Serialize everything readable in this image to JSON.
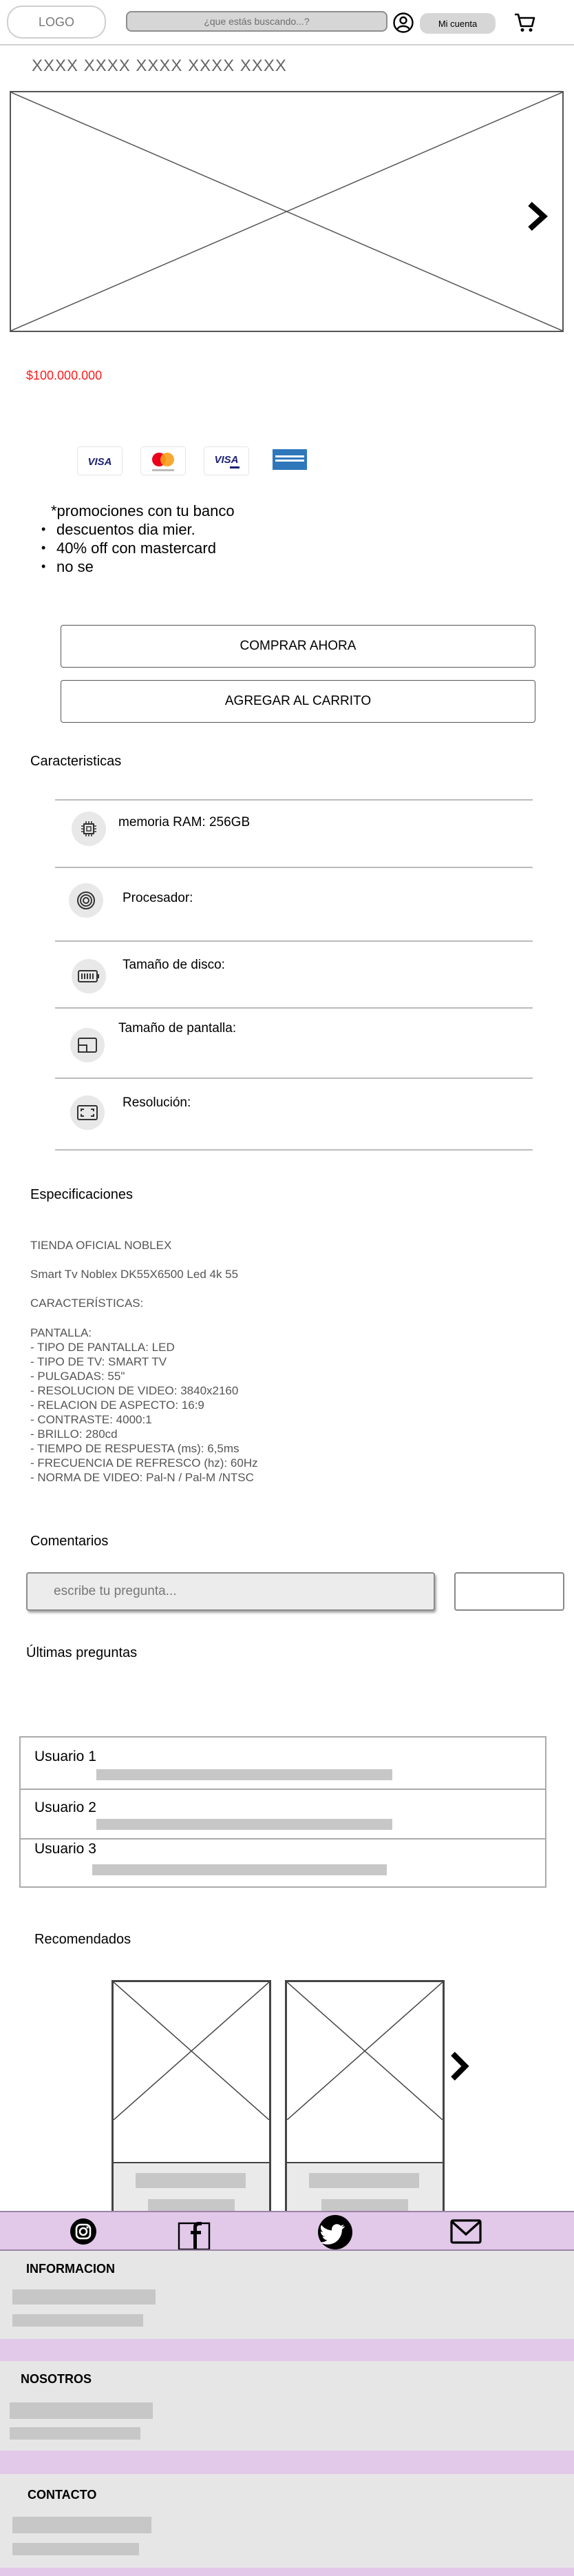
{
  "header": {
    "logo": "LOGO",
    "search_placeholder": "¿que estás buscando...?",
    "account_label": "Mi cuenta"
  },
  "product": {
    "title": "XXXX XXXX XXXX XXXX XXXX",
    "price": "$100.000.000",
    "price_color": "#ff1a1a"
  },
  "payment_cards": [
    "VISA",
    "MASTERCARD",
    "VISA DEBITO",
    "AMERICAN EXPRESS"
  ],
  "promotions": {
    "heading": "*promociones con tu banco",
    "items": [
      "descuentos dia mier.",
      "40% off con mastercard",
      "no se"
    ]
  },
  "buttons": {
    "buy_now": "COMPRAR AHORA",
    "add_to_cart": "AGREGAR AL CARRITO"
  },
  "features": {
    "title": "Caracteristicas",
    "items": [
      {
        "icon": "chip-icon",
        "label": "memoria RAM: 256GB"
      },
      {
        "icon": "processor-icon",
        "label": "Procesador:"
      },
      {
        "icon": "battery-disk-icon",
        "label": "Tamaño de disco:"
      },
      {
        "icon": "screen-size-icon",
        "label": "Tamaño de pantalla:"
      },
      {
        "icon": "resolution-icon",
        "label": "Resolución:"
      }
    ]
  },
  "specifications": {
    "title": "Especificaciones",
    "store": "TIENDA OFICIAL NOBLEX",
    "model": "Smart Tv Noblex DK55X6500 Led 4k 55",
    "characteristics_heading": "CARACTERÍSTICAS:",
    "screen_heading": "PANTALLA:",
    "lines": [
      "- TIPO DE PANTALLA: LED",
      "- TIPO DE TV: SMART TV",
      "- PULGADAS: 55\"",
      "- RESOLUCION DE VIDEO: 3840x2160",
      "- RELACION DE ASPECTO: 16:9",
      "- CONTRASTE: 4000:1",
      "- BRILLO: 280cd",
      "- TIEMPO DE RESPUESTA (ms): 6,5ms",
      "- FRECUENCIA DE REFRESCO (hz): 60Hz",
      "- NORMA DE VIDEO: Pal-N / Pal-M /NTSC"
    ]
  },
  "comments": {
    "title": "Comentarios",
    "placeholder": "escribe tu pregunta..."
  },
  "questions": {
    "title": "Últimas preguntas",
    "users": [
      "Usuario 1",
      "Usuario 2",
      "Usuario 3"
    ]
  },
  "recommended": {
    "title": "Recomendados"
  },
  "social": {
    "icons": [
      "instagram-icon",
      "facebook-icon",
      "twitter-icon",
      "mail-icon"
    ],
    "band_color": "#e2c8e9"
  },
  "footer": {
    "sections": [
      "INFORMACION",
      "NOSOTROS",
      "CONTACTO"
    ]
  }
}
